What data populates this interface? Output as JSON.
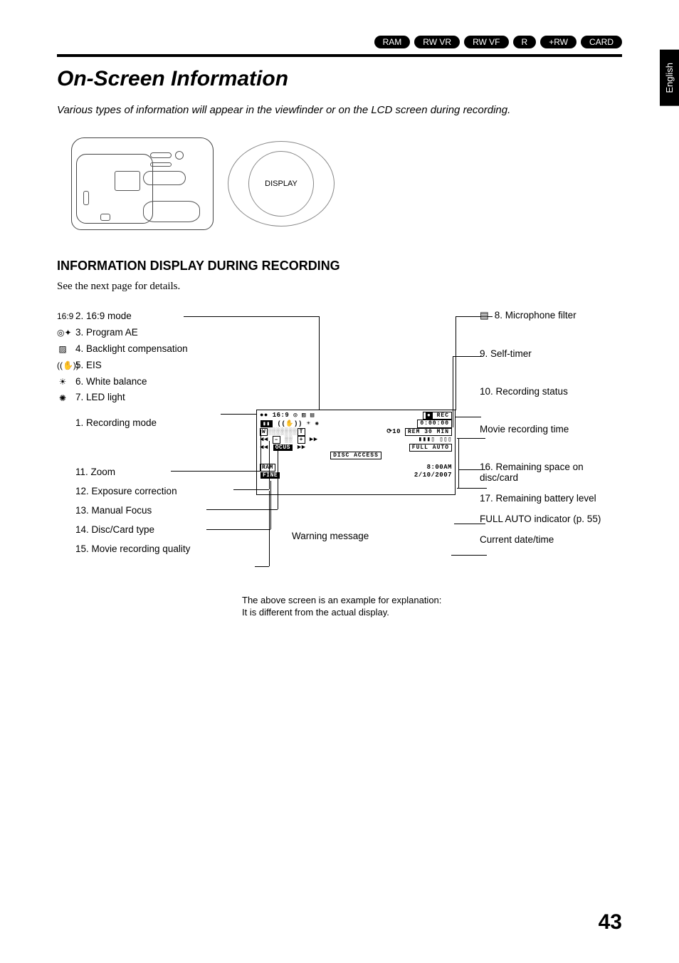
{
  "mediaTypes": [
    "RAM",
    "RW VR",
    "RW VF",
    "R",
    "+RW",
    "CARD"
  ],
  "sideTab": "English",
  "title": "On-Screen Information",
  "intro": "Various types of information will appear in the viewfinder or on the LCD screen during recording.",
  "displayLabel": "DISPLAY",
  "section": "INFORMATION DISPLAY DURING RECORDING",
  "sectionNote": "See the next page for details.",
  "leftTop": [
    {
      "icon": "16:9",
      "label": "2. 16:9 mode"
    },
    {
      "icon": "◎✦",
      "label": "3. Program AE"
    },
    {
      "icon": "▨",
      "label": "4. Backlight compensation"
    },
    {
      "icon": "((✋))",
      "label": "5. EIS"
    },
    {
      "icon": "☀",
      "label": "6. White balance"
    },
    {
      "icon": "✺",
      "label": "7. LED light"
    }
  ],
  "recordingMode": "1. Recording mode",
  "leftBottom": [
    "11. Zoom",
    "12. Exposure correction",
    "13. Manual Focus",
    "14. Disc/Card type",
    "15. Movie recording quality"
  ],
  "rightTop": {
    "icon": "▤",
    "label": "8. Microphone filter"
  },
  "rightList": [
    "9. Self-timer",
    "10. Recording status",
    "Movie recording time",
    "16. Remaining space on disc/card",
    "17. Remaining battery level",
    "FULL AUTO indicator (p. 55)",
    "Current date/time"
  ],
  "warningMessage": "Warning message",
  "screen": {
    "rec": "REC",
    "time": "0:00:00",
    "selftimer": "⟳10",
    "rem": "REM 30 MIN",
    "fullAuto": "FULL AUTO",
    "discAccess": "DISC  ACCESS",
    "clock": "8:00AM",
    "date": "2/10/2007",
    "ram": "RAM",
    "fine": "FINE",
    "w": "W",
    "t": "T",
    "focus": "OCUS",
    "icons": "●● 16:9 ◎ ▨ ▤"
  },
  "footnote1": "The above screen is an example for explanation:",
  "footnote2": "It is different from the actual display.",
  "pageNum": "43"
}
